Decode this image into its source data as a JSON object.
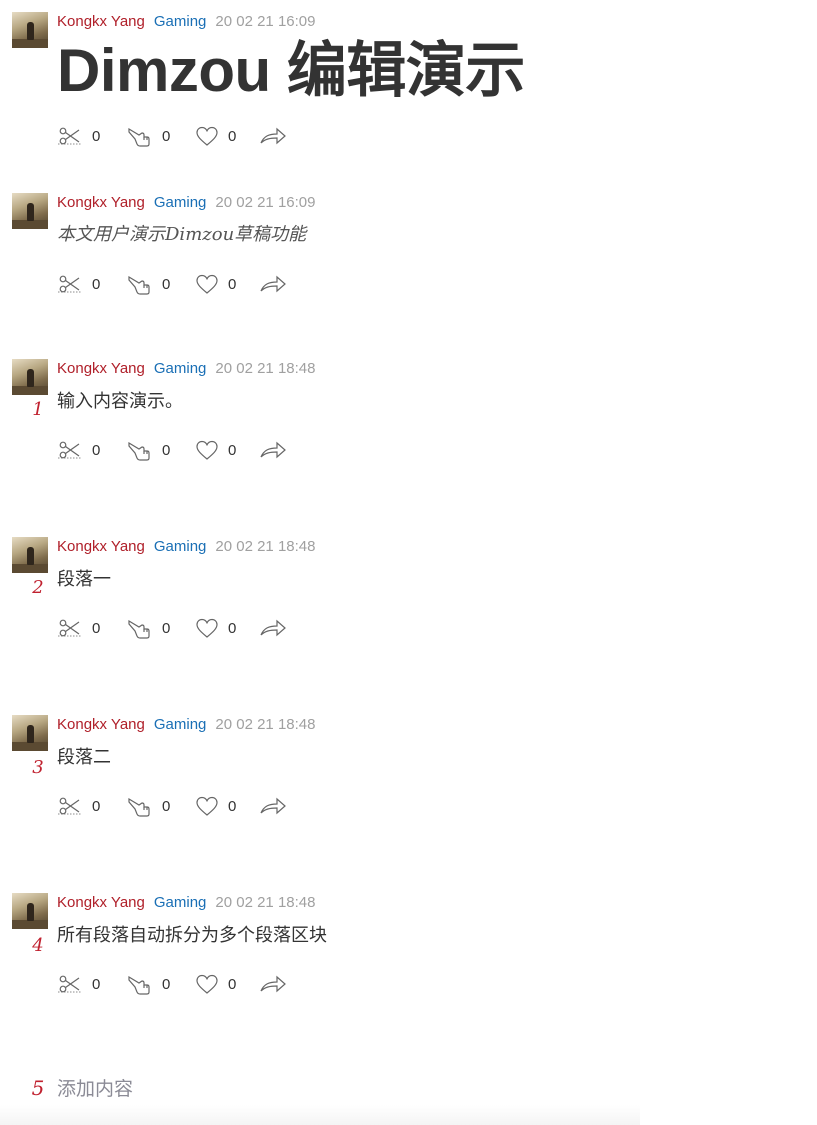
{
  "posts": [
    {
      "author": "Kongkx Yang",
      "category": "Gaming",
      "time": "20 02 21 16:09",
      "number": "",
      "content": "Dimzou 编辑演示",
      "counts": {
        "cut": "0",
        "point": "0",
        "like": "0"
      }
    },
    {
      "author": "Kongkx Yang",
      "category": "Gaming",
      "time": "20 02 21 16:09",
      "number": "",
      "content": "本文用户演示Dimzou草稿功能",
      "counts": {
        "cut": "0",
        "point": "0",
        "like": "0"
      }
    },
    {
      "author": "Kongkx Yang",
      "category": "Gaming",
      "time": "20 02 21 18:48",
      "number": "1",
      "content": "输入内容演示。",
      "counts": {
        "cut": "0",
        "point": "0",
        "like": "0"
      }
    },
    {
      "author": "Kongkx Yang",
      "category": "Gaming",
      "time": "20 02 21 18:48",
      "number": "2",
      "content": "段落一",
      "counts": {
        "cut": "0",
        "point": "0",
        "like": "0"
      }
    },
    {
      "author": "Kongkx Yang",
      "category": "Gaming",
      "time": "20 02 21 18:48",
      "number": "3",
      "content": "段落二",
      "counts": {
        "cut": "0",
        "point": "0",
        "like": "0"
      }
    },
    {
      "author": "Kongkx Yang",
      "category": "Gaming",
      "time": "20 02 21 18:48",
      "number": "4",
      "content": "所有段落自动拆分为多个段落区块",
      "counts": {
        "cut": "0",
        "point": "0",
        "like": "0"
      }
    }
  ],
  "add": {
    "number": "5",
    "label": "添加内容"
  },
  "icons": [
    "scissors-icon",
    "pointing-hand-icon",
    "heart-icon",
    "share-icon"
  ],
  "colors": {
    "author": "#b0202a",
    "category": "#1a6fb5",
    "time": "#a0a0a0",
    "number": "#c0212f",
    "add_text": "#8b8b96"
  }
}
